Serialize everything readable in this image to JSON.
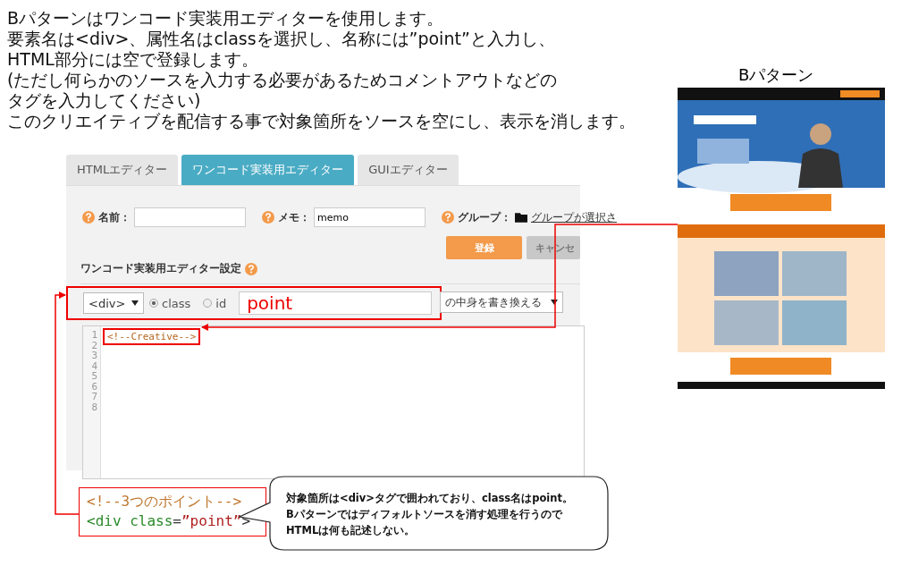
{
  "instructions": [
    "Bパターンはワンコード実装用エディターを使用します。",
    "要素名は<div>、属性名はclassを選択し、名称には”point”と入力し、",
    "HTML部分には空で登録します。",
    "(ただし何らかのソースを入力する必要があるためコメントアウトなどの",
    "タグを入力してください)",
    "このクリエイティブを配信する事で対象箇所をソースを空にし、表示を消します。"
  ],
  "preview": {
    "title": "Bパターン"
  },
  "editor": {
    "tabs": [
      {
        "label": "HTMLエディター",
        "selected": false
      },
      {
        "label": "ワンコード実装用エディター",
        "selected": true
      },
      {
        "label": "GUIエディター",
        "selected": false
      }
    ],
    "fields": [
      {
        "label": "名前："
      },
      {
        "label": "メモ：",
        "value": "memo"
      }
    ],
    "group": {
      "label": "グループ：",
      "link": "グループが選択さ"
    },
    "buttons": [
      {
        "label": "登録",
        "kind": "primary"
      },
      {
        "label": "キャンセ",
        "kind": "secondary"
      }
    ],
    "section_title": "ワンコード実装用エディター設定",
    "element_select": "<div>",
    "attribute_options": [
      {
        "label": "class",
        "selected": true
      },
      {
        "label": "id",
        "selected": false
      }
    ],
    "name_value": "point",
    "action_select": "の中身を書き換える",
    "line_numbers": [
      "1",
      "2",
      "3",
      "4",
      "5",
      "6",
      "7",
      "8"
    ],
    "code_line": "<!--Creative-->"
  },
  "snippet": {
    "lines": [
      [
        {
          "kind": "comment",
          "text": "<!--3つのポイント-->"
        }
      ],
      [
        {
          "kind": "tag",
          "text": "<div "
        },
        {
          "kind": "attr",
          "text": "class"
        },
        {
          "kind": "punct",
          "text": "="
        },
        {
          "kind": "string",
          "text": "”point”"
        },
        {
          "kind": "punct",
          "text": ">"
        }
      ]
    ]
  },
  "callout": {
    "lines": [
      "対象箇所は<div>タグで囲われており、class名はpoint。",
      "Bパターンではディフォルトソースを消す処理を行うので",
      "HTMLは何も記述しない。"
    ]
  }
}
